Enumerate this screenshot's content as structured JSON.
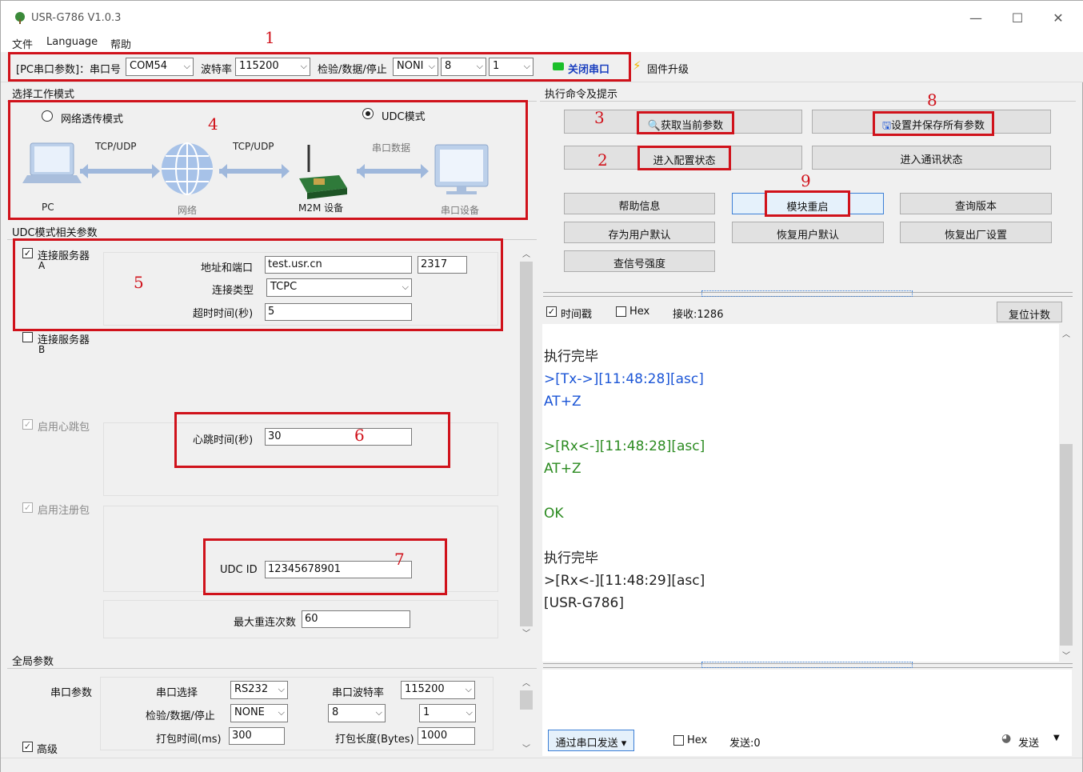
{
  "window": {
    "title": "USR-G786 V1.0.3",
    "controls": [
      "—",
      "☐",
      "✕"
    ]
  },
  "menu": [
    "文件",
    "Language",
    "帮助"
  ],
  "toolbar": {
    "pc_port_label": "[PC串口参数]：串口号",
    "port_value": "COM54",
    "baud_label": "波特率",
    "baud_value": "115200",
    "parity_label": "检验/数据/停止",
    "parity_value": "NONI",
    "data_bits": "8",
    "stop_bits": "1",
    "close_port": "关闭串口",
    "firmware": "固件升级"
  },
  "work_mode": {
    "header": "选择工作模式",
    "option_transparent": "网络透传模式",
    "option_udc": "UDC模式",
    "selected": "UDC模式",
    "diagram": {
      "pc": "PC",
      "tcp1": "TCP/UDP",
      "net": "网络",
      "tcp2": "TCP/UDP",
      "m2m": "M2M 设备",
      "serial_data": "串口数据",
      "serial_dev": "串口设备"
    }
  },
  "udc_params": {
    "header": "UDC模式相关参数",
    "server_a_label": "连接服务器",
    "server_a_sub": "A",
    "server_a_checked": true,
    "addr_label": "地址和端口",
    "addr_value": "test.usr.cn",
    "port_value": "2317",
    "conn_type_label": "连接类型",
    "conn_type_value": "TCPC",
    "timeout_label": "超时时间(秒)",
    "timeout_value": "5",
    "server_b_label": "连接服务器",
    "server_b_sub": "B",
    "server_b_checked": false,
    "heartbeat_enable": "启用心跳包",
    "heartbeat_label": "心跳时间(秒)",
    "heartbeat_value": "30",
    "register_enable": "启用注册包",
    "udc_id_label": "UDC ID",
    "udc_id_value": "12345678901",
    "max_reconnect_label": "最大重连次数",
    "max_reconnect_value": "60"
  },
  "global_params": {
    "header": "全局参数",
    "serial_params": "串口参数",
    "serial_select_label": "串口选择",
    "serial_select_value": "RS232",
    "serial_baud_label": "串口波特率",
    "serial_baud_value": "115200",
    "parity_label": "检验/数据/停止",
    "parity_value": "NONE",
    "data_bits": "8",
    "stop_bits": "1",
    "pack_time_label": "打包时间(ms)",
    "pack_time_value": "300",
    "pack_len_label": "打包长度(Bytes)",
    "pack_len_value": "1000",
    "advanced": "高级"
  },
  "commands": {
    "header": "执行命令及提示",
    "get_params": "获取当前参数",
    "save_all": "设置并保存所有参数",
    "enter_config": "进入配置状态",
    "enter_comm": "进入通讯状态",
    "help": "帮助信息",
    "reboot": "模块重启",
    "query_version": "查询版本",
    "save_user_default": "存为用户默认",
    "restore_user_default": "恢复用户默认",
    "factory_reset": "恢复出厂设置",
    "signal_strength": "查信号强度"
  },
  "log_options": {
    "timestamp": "时间戳",
    "hex": "Hex",
    "received": "接收:1286",
    "reset_count": "复位计数"
  },
  "log": [
    {
      "text": "执行完毕",
      "color": "dark"
    },
    {
      "text": ">[Tx->][11:48:28][asc]",
      "color": "blue"
    },
    {
      "text": "AT+Z",
      "color": "blue"
    },
    {
      "text": "",
      "color": "dark"
    },
    {
      "text": ">[Rx<-][11:48:28][asc]",
      "color": "green"
    },
    {
      "text": "AT+Z",
      "color": "green"
    },
    {
      "text": "",
      "color": "dark"
    },
    {
      "text": "OK",
      "color": "green"
    },
    {
      "text": "",
      "color": "dark"
    },
    {
      "text": "执行完毕",
      "color": "dark"
    },
    {
      "text": ">[Rx<-][11:48:29][asc]",
      "color": "dark"
    },
    {
      "text": "[USR-G786]",
      "color": "dark"
    }
  ],
  "send_bar": {
    "send_via": "通过串口发送",
    "hex": "Hex",
    "sent": "发送:0",
    "send": "发送"
  },
  "annotations": [
    "1",
    "2",
    "3",
    "4",
    "5",
    "6",
    "7",
    "8",
    "9"
  ],
  "colors": {
    "annotation_red": "#d0121b",
    "log_blue": "#1b55d6",
    "log_green": "#2c8b21",
    "status_green": "#1bbf2a"
  }
}
